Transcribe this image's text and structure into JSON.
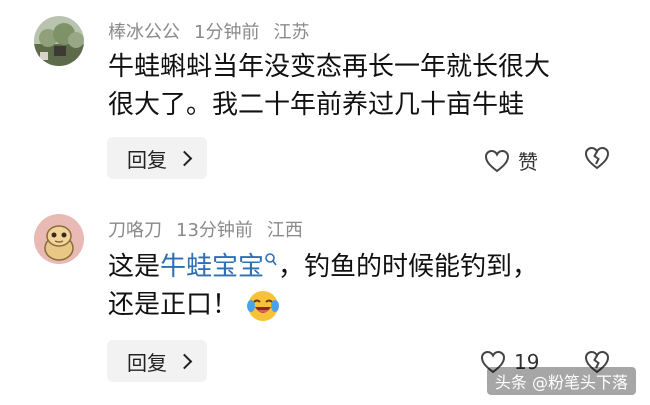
{
  "comments": [
    {
      "author": "棒冰公公",
      "time": "1分钟前",
      "location": "江苏",
      "text_line1": "牛蛙蝌蚪当年没变态再长一年就长很大",
      "text_line2": "很大了。我二十年前养过几十亩牛蛙",
      "reply_label": "回复",
      "like_label": "赞"
    },
    {
      "author": "刀咯刀",
      "time": "13分钟前",
      "location": "江西",
      "text_prefix": "这是",
      "mention": "牛蛙宝宝",
      "text_suffix": "，钓鱼的时候能钓到，",
      "text_line2": "还是正口！",
      "reply_label": "回复",
      "like_count": "19"
    }
  ],
  "watermark": "头条 @粉笔头下落"
}
